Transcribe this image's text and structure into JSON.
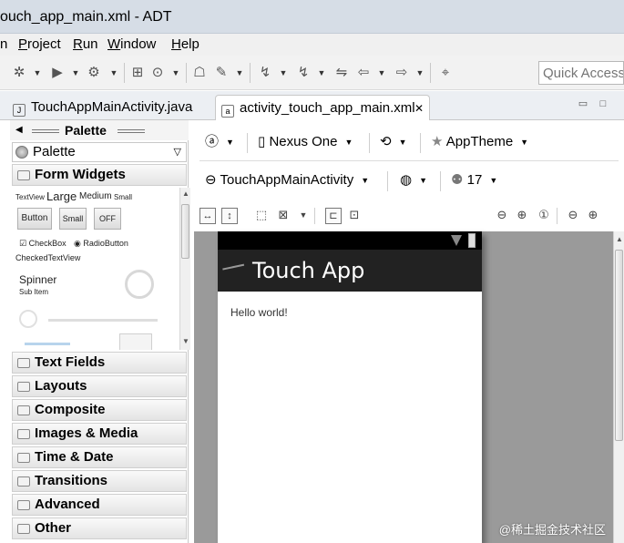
{
  "window": {
    "title": "ouch_app_main.xml - ADT"
  },
  "menu": [
    {
      "label": "n",
      "key": ""
    },
    {
      "label": "roject",
      "key": "P"
    },
    {
      "label": "un",
      "key": "R"
    },
    {
      "label": "indow",
      "key": "W"
    },
    {
      "label": "elp",
      "key": "H"
    }
  ],
  "quick_access": {
    "placeholder": "Quick Access"
  },
  "tabs": [
    {
      "label": "TouchAppMainActivity.java",
      "active": false
    },
    {
      "label": "activity_touch_app_main.xml",
      "active": true,
      "close": "✕"
    }
  ],
  "palette": {
    "header": "Palette",
    "combo": "Palette",
    "open_category": "Form Widgets",
    "widgets": {
      "textview": "TextView",
      "large": "Large",
      "medium": "Medium",
      "small_text": "Small",
      "button": "Button",
      "small_button": "Small",
      "toggle": "OFF",
      "checkbox": "CheckBox",
      "radio": "RadioButton",
      "checked_text": "CheckedTextView",
      "spinner": "Spinner",
      "sub_item": "Sub Item"
    },
    "categories": [
      "Text Fields",
      "Layouts",
      "Composite",
      "Images & Media",
      "Time & Date",
      "Transitions",
      "Advanced",
      "Other"
    ]
  },
  "editor": {
    "device": "Nexus One",
    "theme": "AppTheme",
    "activity": "TouchAppMainActivity",
    "api_level": "17"
  },
  "preview": {
    "app_title": "Touch App",
    "body_text": "Hello world!"
  },
  "watermark": "@稀土掘金技术社区",
  "colors": {
    "action_bar": "#222222",
    "status_bar": "#000000",
    "canvas": "#9a9a9a"
  }
}
